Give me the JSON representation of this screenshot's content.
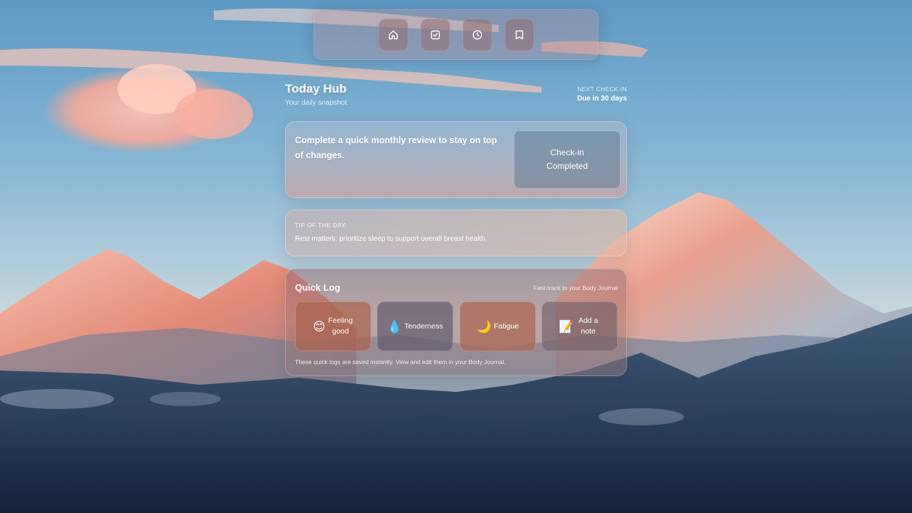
{
  "nav": {
    "items": [
      {
        "name": "home-icon"
      },
      {
        "name": "checkbox-icon"
      },
      {
        "name": "clock-icon"
      },
      {
        "name": "journal-icon"
      }
    ]
  },
  "header": {
    "title": "Today Hub",
    "subtitle": "Your daily snapshot",
    "next_checkin_label": "NEXT CHECK-IN",
    "next_checkin_value": "Due in 30 days"
  },
  "review": {
    "text": "Complete a quick monthly review to stay on top of changes.",
    "button_label": "Check-in Completed"
  },
  "tip": {
    "label": "TIP OF THE DAY",
    "text": "Rest matters: prioritize sleep to support overall breast health."
  },
  "quick_log": {
    "title": "Quick Log",
    "subtitle": "Fast-track to your Body Journal",
    "buttons": [
      {
        "emoji": "😊",
        "label": "Feeling good"
      },
      {
        "emoji": "💧",
        "label": "Tenderness"
      },
      {
        "emoji": "🌙",
        "label": "Fatigue"
      },
      {
        "emoji": "📝",
        "label": "Add a note"
      }
    ],
    "footer": "These quick logs are saved instantly. View and edit them in your Body Journal."
  }
}
